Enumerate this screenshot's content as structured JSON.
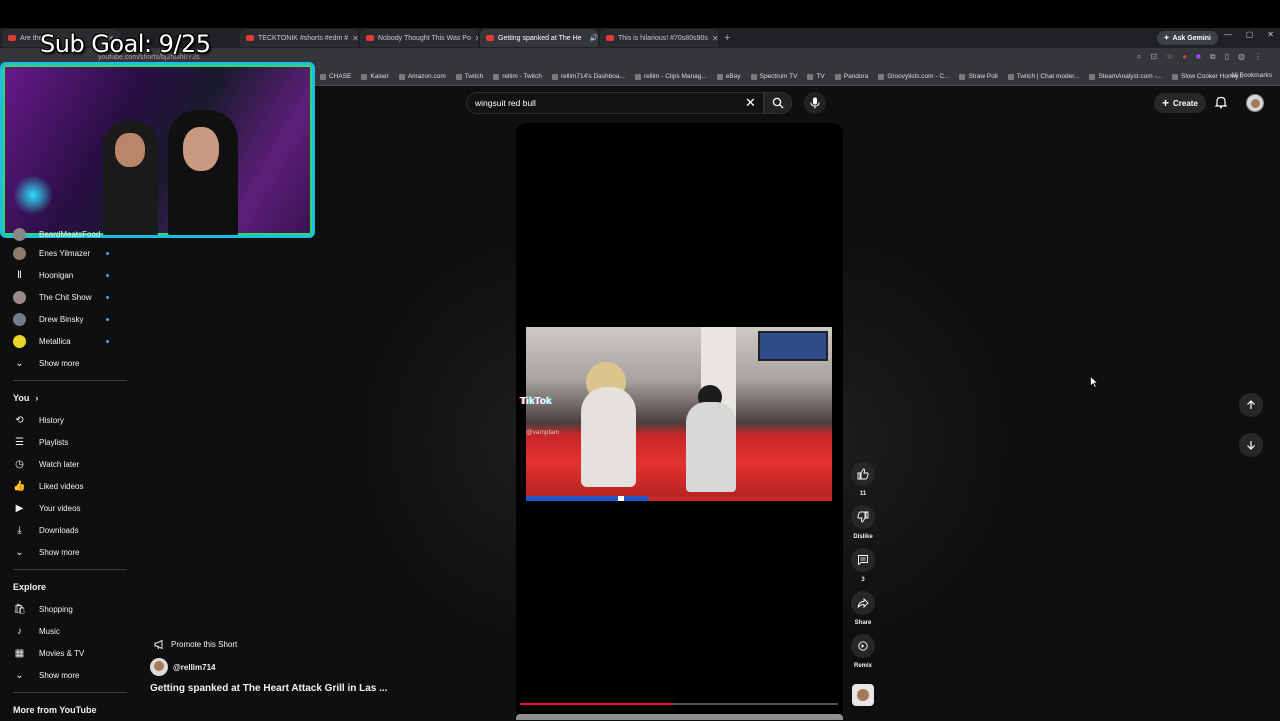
{
  "stream_overlay": {
    "sub_goal": "Sub Goal: 9/25"
  },
  "browser": {
    "tabs": [
      {
        "title": "Are the...",
        "active": false
      },
      {
        "title": "TECKTONIK #shorts #edm #",
        "active": false
      },
      {
        "title": "Nobody Thought This Was Po",
        "active": false
      },
      {
        "title": "Getting spanked at The He",
        "active": true
      },
      {
        "title": "This is hilarious! #70s80s90s",
        "active": false
      }
    ],
    "new_tab_icon": "plus-icon",
    "ask_gemini": "Ask Gemini",
    "url": "youtube.com/shorts/bj2hbih0Y2s",
    "bookmarks": [
      "CHASE",
      "Kaiser",
      "Amazon.com",
      "Twitch",
      "rellim - Twitch",
      "rellim714's Dashboa...",
      "rellim - Clips Manag...",
      "eBay",
      "Spectrum TV",
      "TV",
      "Pandora",
      "Groovylists.com - C...",
      "Straw Poll",
      "Twitch | Chat moder...",
      "SteamAnalyst.com -...",
      "Slow Cooker Honey..."
    ],
    "all_bookmarks": "All Bookmarks"
  },
  "search": {
    "query": "wingsuit red bull"
  },
  "header": {
    "create_label": "Create"
  },
  "sidebar": {
    "subscriptions": [
      {
        "label": "BeardMeatsFood",
        "new": true
      },
      {
        "label": "Enes Yilmazer",
        "new": true
      },
      {
        "label": "Hoonigan",
        "new": true
      },
      {
        "label": "The Chit Show",
        "new": true
      },
      {
        "label": "Drew Binsky",
        "new": true
      },
      {
        "label": "Metallica",
        "new": true
      }
    ],
    "subs_show_more": "Show more",
    "you_heading": "You",
    "you_items": [
      {
        "label": "History",
        "icon": "history-icon"
      },
      {
        "label": "Playlists",
        "icon": "playlists-icon"
      },
      {
        "label": "Watch later",
        "icon": "watch-later-icon"
      },
      {
        "label": "Liked videos",
        "icon": "liked-icon"
      },
      {
        "label": "Your videos",
        "icon": "your-videos-icon"
      },
      {
        "label": "Downloads",
        "icon": "download-icon"
      }
    ],
    "you_show_more": "Show more",
    "explore_heading": "Explore",
    "explore_items": [
      {
        "label": "Shopping",
        "icon": "shopping-icon"
      },
      {
        "label": "Music",
        "icon": "music-icon"
      },
      {
        "label": "Movies & TV",
        "icon": "movies-icon"
      }
    ],
    "explore_show_more": "Show more",
    "more_from_youtube": "More from YouTube"
  },
  "video": {
    "watermark": "TikTok",
    "watermark_handle": "@vampfam",
    "progress": 0.48
  },
  "actions": {
    "like_count": "11",
    "dislike_label": "Dislike",
    "comment_count": "3",
    "share_label": "Share",
    "remix_label": "Remix"
  },
  "short": {
    "promote": "Promote this Short",
    "channel": "@rellim714",
    "title": "Getting spanked at The Heart Attack Grill in Las ..."
  },
  "colors": {
    "background": "#0f0f0f",
    "accent": "#ff0033",
    "new_dot": "#3ea6ff",
    "webcam_border": "#18c0e6"
  }
}
